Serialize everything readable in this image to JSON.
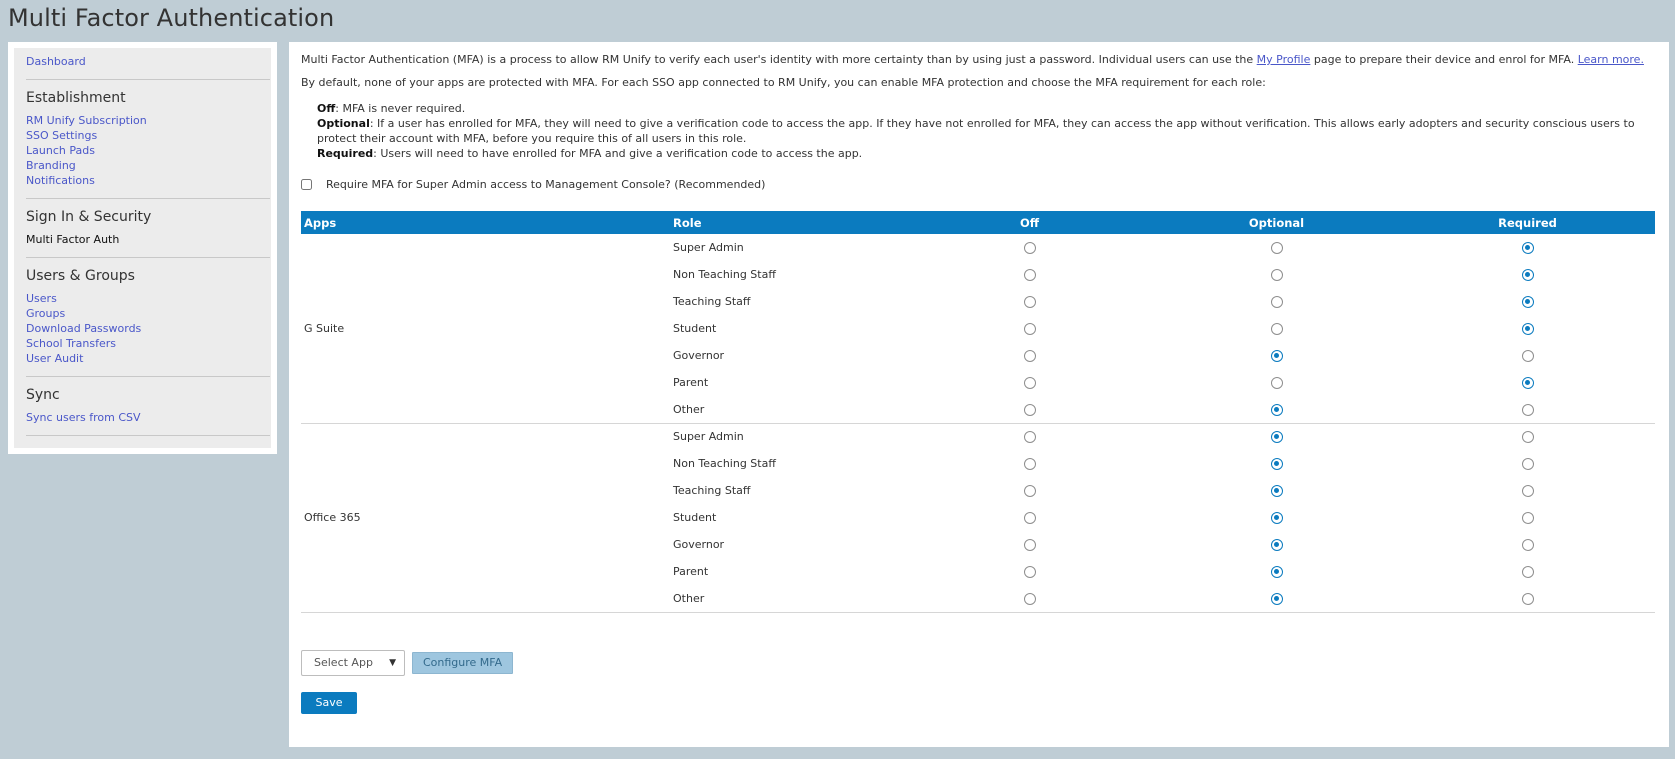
{
  "page": {
    "title": "Multi Factor Authentication"
  },
  "sidebar": {
    "dashboard": "Dashboard",
    "groups": [
      {
        "heading": "Establishment",
        "items": [
          "RM Unify Subscription",
          "SSO Settings",
          "Launch Pads",
          "Branding",
          "Notifications"
        ]
      },
      {
        "heading": "Sign In & Security",
        "items": [
          "Multi Factor Auth"
        ]
      },
      {
        "heading": "Users & Groups",
        "items": [
          "Users",
          "Groups",
          "Download Passwords",
          "School Transfers",
          "User Audit"
        ]
      },
      {
        "heading": "Sync",
        "items": [
          "Sync users from CSV"
        ]
      }
    ],
    "active_item": "Multi Factor Auth"
  },
  "main": {
    "intro_1": "Multi Factor Authentication (MFA) is a process to allow RM Unify to verify each user's identity with more certainty than by using just a password. Individual users can use the",
    "my_profile_link": "My Profile",
    "intro_1b": "page to prepare their device and enrol for MFA.",
    "learn_more_link": "Learn more.",
    "intro_2": "By default, none of your apps are protected with MFA. For each SSO app connected to RM Unify, you can enable MFA protection and choose the MFA requirement for each role:",
    "options": [
      {
        "term": "Off",
        "desc": ": MFA is never required."
      },
      {
        "term": "Optional",
        "desc": ": If a user has enrolled for MFA, they will need to give a verification code to access the app. If they have not enrolled for MFA, they can access the app without verification. This allows early adopters and security conscious users to protect their account with MFA, before you require this of all users in this role."
      },
      {
        "term": "Required",
        "desc": ": Users will need to have enrolled for MFA and give a verification code to access the app."
      }
    ],
    "super_admin_checkbox": {
      "label": "Require MFA for Super Admin access to Management Console? (Recommended)",
      "checked": false
    }
  },
  "table": {
    "headers": {
      "apps": "Apps",
      "role": "Role",
      "off": "Off",
      "optional": "Optional",
      "required": "Required"
    },
    "apps": [
      {
        "name": "G Suite",
        "roles": [
          {
            "role": "Super Admin",
            "setting": "Required"
          },
          {
            "role": "Non Teaching Staff",
            "setting": "Required"
          },
          {
            "role": "Teaching Staff",
            "setting": "Required"
          },
          {
            "role": "Student",
            "setting": "Required"
          },
          {
            "role": "Governor",
            "setting": "Optional"
          },
          {
            "role": "Parent",
            "setting": "Required"
          },
          {
            "role": "Other",
            "setting": "Optional"
          }
        ]
      },
      {
        "name": "Office 365",
        "roles": [
          {
            "role": "Super Admin",
            "setting": "Optional"
          },
          {
            "role": "Non Teaching Staff",
            "setting": "Optional"
          },
          {
            "role": "Teaching Staff",
            "setting": "Optional"
          },
          {
            "role": "Student",
            "setting": "Optional"
          },
          {
            "role": "Governor",
            "setting": "Optional"
          },
          {
            "role": "Parent",
            "setting": "Optional"
          },
          {
            "role": "Other",
            "setting": "Optional"
          }
        ]
      }
    ]
  },
  "controls": {
    "select_app": "Select App",
    "configure": "Configure MFA",
    "save": "Save"
  },
  "colors": {
    "accent": "#0b7bbf",
    "background": "#bfcdd5",
    "link": "#4a57c9"
  }
}
